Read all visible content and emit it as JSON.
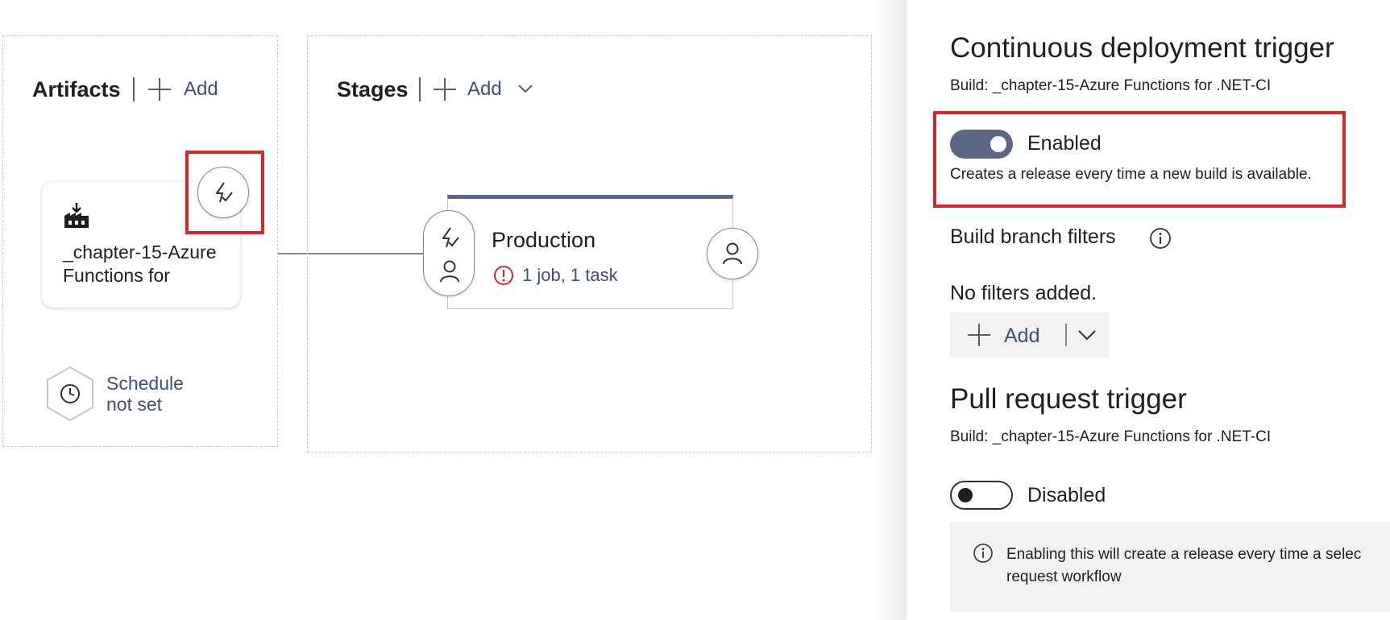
{
  "artifacts": {
    "title": "Artifacts",
    "add_label": "Add",
    "card_text": "_chapter-15-Azure Functions for",
    "schedule_line1": "Schedule",
    "schedule_line2": "not set"
  },
  "stages": {
    "title": "Stages",
    "add_label": "Add",
    "stage_name": "Production",
    "stage_status": "1 job, 1 task"
  },
  "panel": {
    "cd_title": "Continuous deployment trigger",
    "cd_build": "Build: _chapter-15-Azure Functions for .NET-CI",
    "cd_toggle_label": "Enabled",
    "cd_toggle_on": true,
    "cd_desc": "Creates a release every time a new build is available.",
    "branch_filters_label": "Build branch filters",
    "no_filters": "No filters added.",
    "add_label": "Add",
    "pr_title": "Pull request trigger",
    "pr_build": "Build: _chapter-15-Azure Functions for .NET-CI",
    "pr_toggle_label": "Disabled",
    "pr_toggle_on": false,
    "pr_info_line1": "Enabling this will create a release every time a selec",
    "pr_info_line2": "request workflow"
  },
  "colors": {
    "highlight": "#d6262b",
    "accent": "#5c6784",
    "link": "#3f5173",
    "error": "#d6262b"
  }
}
